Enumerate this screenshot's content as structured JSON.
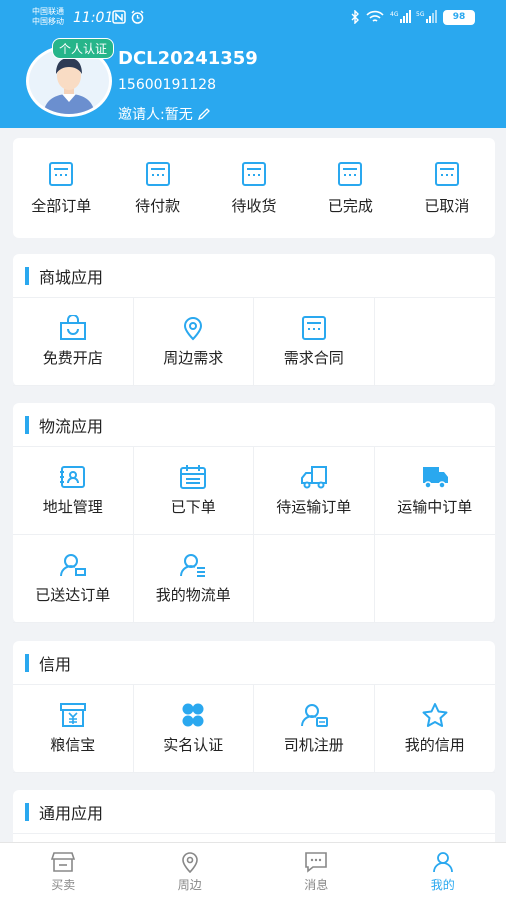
{
  "status_bar": {
    "carrier1": "中国联通",
    "carrier2": "中国移动",
    "time": "11:01",
    "battery": "98"
  },
  "profile": {
    "badge": "个人认证",
    "username": "DCL20241359",
    "phone": "15600191128",
    "inviter": "邀请人:暂无"
  },
  "orders": [
    {
      "label": "全部订单",
      "icon": "order-list-icon"
    },
    {
      "label": "待付款",
      "icon": "order-list-icon"
    },
    {
      "label": "待收货",
      "icon": "order-list-icon"
    },
    {
      "label": "已完成",
      "icon": "order-list-icon"
    },
    {
      "label": "已取消",
      "icon": "order-list-icon"
    }
  ],
  "mall": {
    "title": "商城应用",
    "items": [
      {
        "label": "免费开店",
        "icon": "shop-bag-icon"
      },
      {
        "label": "周边需求",
        "icon": "location-pin-icon"
      },
      {
        "label": "需求合同",
        "icon": "contract-icon"
      }
    ]
  },
  "logistics": {
    "title": "物流应用",
    "items": [
      {
        "label": "地址管理",
        "icon": "address-card-icon"
      },
      {
        "label": "已下单",
        "icon": "calendar-icon"
      },
      {
        "label": "待运输订单",
        "icon": "truck-outline-icon"
      },
      {
        "label": "运输中订单",
        "icon": "truck-filled-icon"
      },
      {
        "label": "已送达订单",
        "icon": "user-delivered-icon"
      },
      {
        "label": "我的物流单",
        "icon": "user-list-icon"
      }
    ]
  },
  "credit": {
    "title": "信用",
    "items": [
      {
        "label": "粮信宝",
        "icon": "yuan-box-icon"
      },
      {
        "label": "实名认证",
        "icon": "four-dots-icon"
      },
      {
        "label": "司机注册",
        "icon": "driver-card-icon"
      },
      {
        "label": "我的信用",
        "icon": "star-icon"
      }
    ]
  },
  "general": {
    "title": "通用应用"
  },
  "tabs": [
    {
      "label": "买卖",
      "icon": "store-icon"
    },
    {
      "label": "周边",
      "icon": "location-pin-icon"
    },
    {
      "label": "消息",
      "icon": "message-icon"
    },
    {
      "label": "我的",
      "icon": "user-icon"
    }
  ],
  "colors": {
    "primary": "#2aa8ef",
    "badge": "#26b58a",
    "background": "#f1f3f6"
  }
}
